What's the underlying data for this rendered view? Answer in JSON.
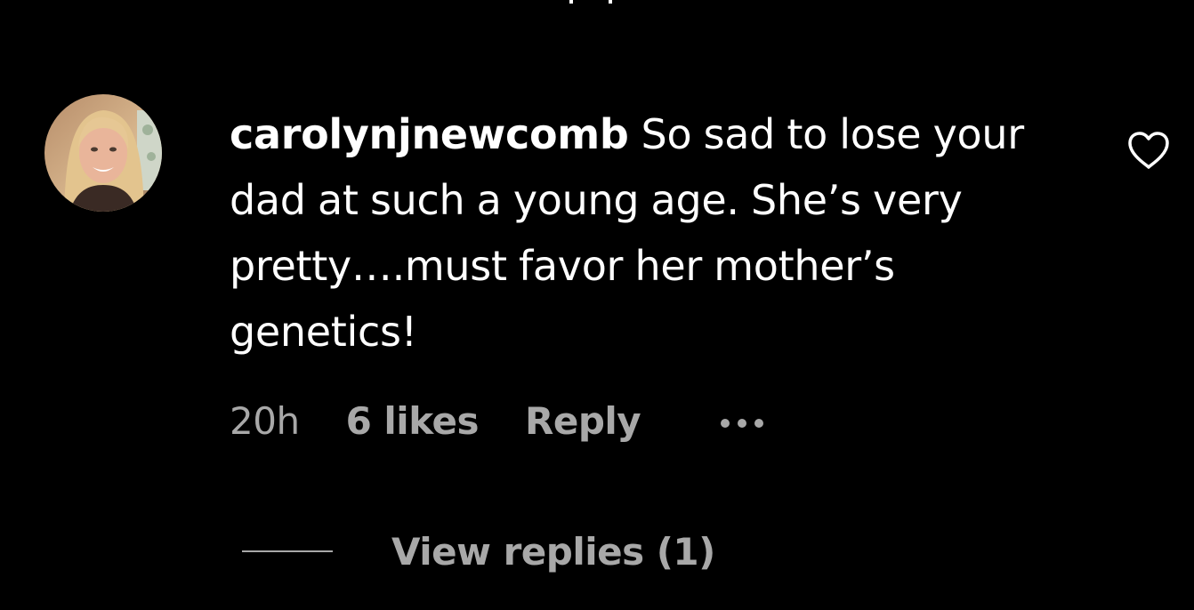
{
  "comment": {
    "username": "carolynjnewcomb",
    "text": "So sad to lose your dad at such a young age. She’s very pretty….must favor her mother’s genetics!",
    "avatar_icon": "profile-photo",
    "like_icon": "heart-outline-icon"
  },
  "meta": {
    "timestamp": "20h",
    "likes": "6 likes",
    "reply_label": "Reply",
    "more_icon": "more-options-icon"
  },
  "replies": {
    "label": "View replies (1)"
  },
  "colors": {
    "background": "#000000",
    "primary_text": "#ffffff",
    "secondary_text": "#a8a8a8"
  }
}
